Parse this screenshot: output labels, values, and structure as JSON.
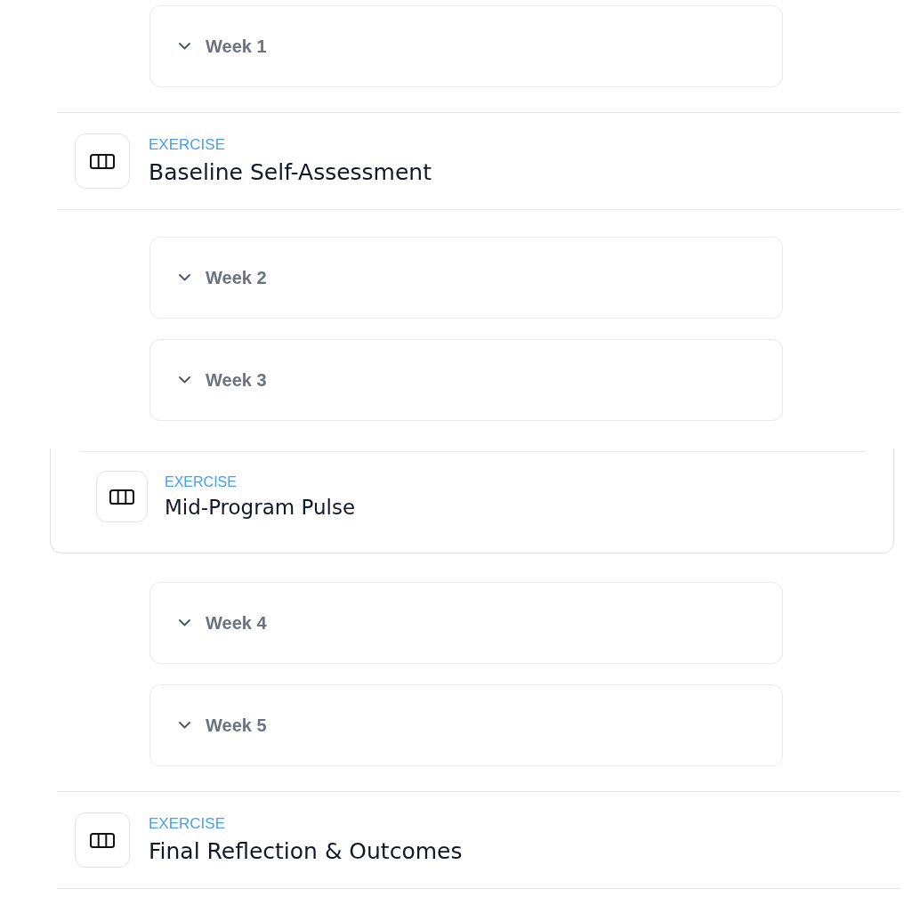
{
  "items": [
    {
      "kind": "week",
      "label": "Week 1",
      "expanded": false
    },
    {
      "kind": "exercise",
      "tag": "EXERCISE",
      "title": "Baseline Self-Assessment",
      "selected": false
    },
    {
      "kind": "week",
      "label": "Week 2",
      "expanded": false
    },
    {
      "kind": "week",
      "label": "Week 3",
      "expanded": false
    },
    {
      "kind": "exercise",
      "tag": "EXERCISE",
      "title": "Mid-Program Pulse",
      "selected": true
    },
    {
      "kind": "week",
      "label": "Week 4",
      "expanded": false
    },
    {
      "kind": "week",
      "label": "Week 5",
      "expanded": false
    },
    {
      "kind": "exercise",
      "tag": "EXERCISE",
      "title": "Final Reflection & Outcomes",
      "selected": false
    }
  ]
}
